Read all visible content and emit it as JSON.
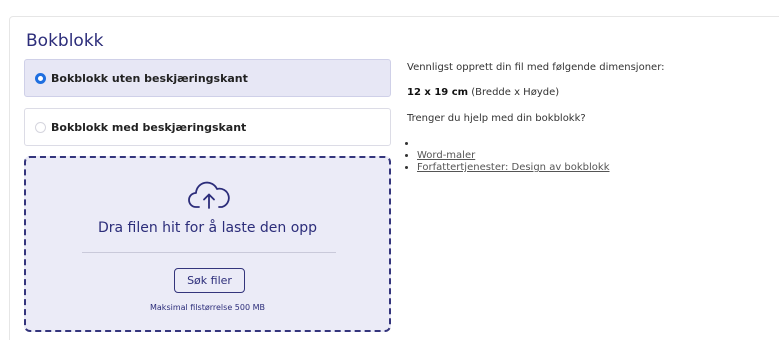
{
  "section": {
    "title": "Bokblokk"
  },
  "options": [
    {
      "label": "Bokblokk uten beskjæringskant",
      "selected": true
    },
    {
      "label": "Bokblokk med beskjæringskant",
      "selected": false
    }
  ],
  "dropzone": {
    "icon": "cloud-upload-icon",
    "text": "Dra filen hit for å laste den opp",
    "browse_label": "Søk filer",
    "max_size": "Maksimal filstørrelse 500 MB"
  },
  "info": {
    "intro": "Vennligst opprett din fil med følgende dimensjoner:",
    "dimensions_value": "12 x 19 cm",
    "dimensions_note": " (Bredde x Høyde)",
    "help": "Trenger du hjelp med din bokblokk?",
    "links": [
      "",
      "Word-maler",
      "Forfattertjenester: Design av bokblokk"
    ]
  },
  "colors": {
    "accent": "#2c2d7a",
    "radio_selected": "#1f6fe0",
    "selected_bg": "#e7e7f5",
    "dropzone_bg": "#ebebf7"
  }
}
